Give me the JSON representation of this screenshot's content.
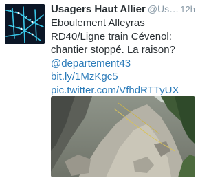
{
  "tweet": {
    "author_name": "Usagers Haut Allier",
    "author_handle": "@Us…",
    "time": "12h",
    "lines": [
      "Eboulement Alleyras",
      "RD40/Ligne train Cévenol:",
      "chantier stoppé. La raison?"
    ],
    "mention": "@departement43",
    "link_short": "bit.ly/1MzKgc5",
    "link_pic": "pic.twitter.com/VfhdRTTyUX"
  },
  "colors": {
    "name": "#292f33",
    "meta": "#8899a6",
    "link": "#2b7bb9"
  },
  "icons": {
    "avatar": "avatar-rail-map-icon"
  }
}
